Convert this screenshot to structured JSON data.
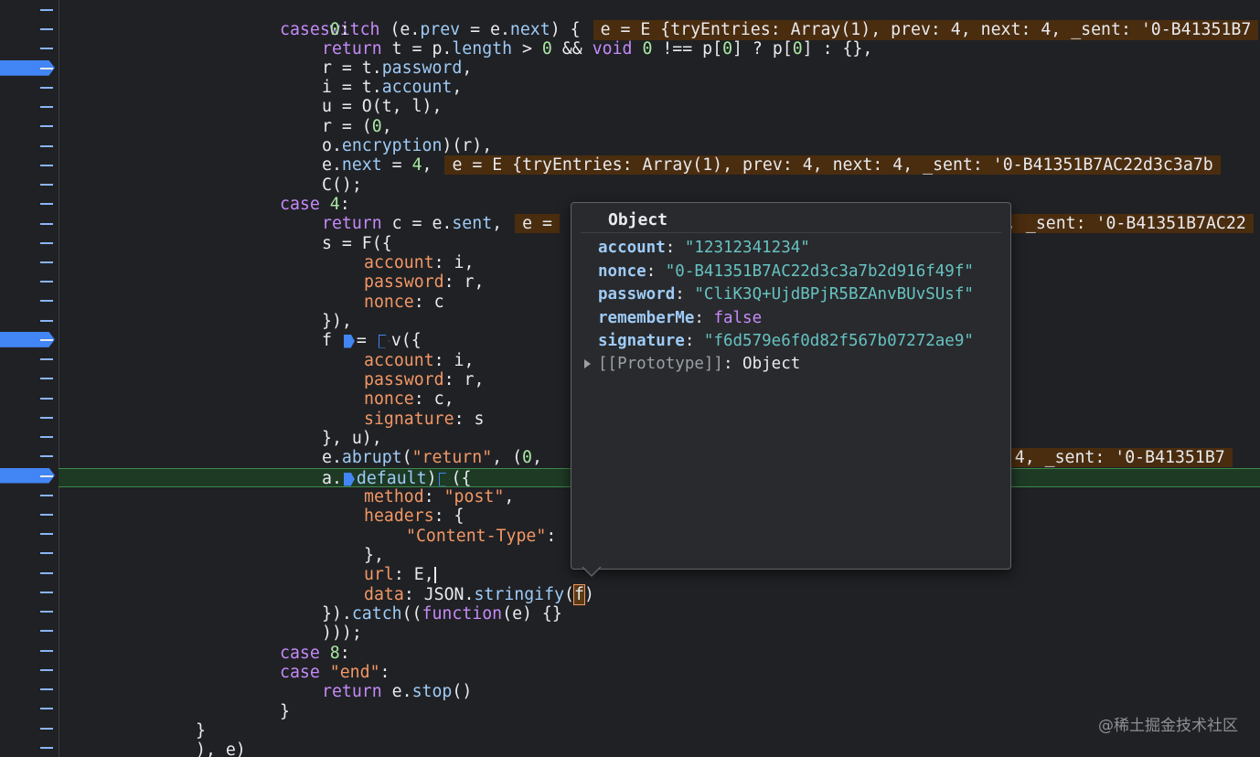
{
  "gutter": {
    "line_count": 39,
    "breakpoint_rows": [
      3,
      17,
      24
    ],
    "breakpoint_color": "#4285f4"
  },
  "code": {
    "switch_head": "switch (e.prev = e.next) {",
    "switch_inline": "e = E {tryEntries: Array(1), prev: 4, next: 4, _sent: '0-B41351B7",
    "case0": "case 0:",
    "return_line": "return t = p.length > 0 && void 0 !== p[0] ? p[0] : {},",
    "r_line": "r = t.password,",
    "i_line": "i = t.account,",
    "u_line": "u = O(t, l),",
    "r2_line": "r = (0,",
    "enc_line": "o.encryption)(r),",
    "next_line": "e.next = 4,",
    "next_inline": "e = E {tryEntries: Array(1), prev: 4, next: 4, _sent: '0-B41351B7AC22d3c3a7b",
    "c_line": "C();",
    "case4": "case 4:",
    "return_c": "return c = e.sent,",
    "return_c_inline_left": "e =",
    "return_c_inline_right": ", _sent: '0-B41351B7AC22",
    "s_line": "s = F({",
    "account_i": "account: i,",
    "password_r": "password: r,",
    "nonce_c": "nonce: c",
    "close_paren": "}),",
    "f_line_pre": "f",
    "f_line_mid": "= ",
    "f_line_post": "v({",
    "account_i2": "account: i,",
    "password_r2": "password: r,",
    "nonce_c2": "nonce: c,",
    "signature_s": "signature: s",
    "close_u": "}, u),",
    "abrupt": "e.abrupt(\"return\", (0,",
    "abrupt_inline": "t: 4, _sent: '0-B41351B7",
    "exec_pre": "a.",
    "exec_mid": "default)",
    "exec_post": "({",
    "method": "method: \"post\",",
    "headers": "headers: {",
    "content_type": "\"Content-Type\":",
    "close_brace": "},",
    "url": "url: E,",
    "data_pre": "data: JSON.stringify(",
    "data_hl": "f",
    "data_post": ")",
    "catch": "}).catch((function(e) {}",
    "close_triple": ")));",
    "case8": "case 8:",
    "case_end": "case \"end\":",
    "return_stop": "return e.stop()",
    "close_switch": "}",
    "close_outer": "}",
    "close_e": "), e)"
  },
  "popover": {
    "title": "Object",
    "rows": [
      {
        "key": "account",
        "value": "\"12312341234\"",
        "kind": "string"
      },
      {
        "key": "nonce",
        "value": "\"0-B41351B7AC22d3c3a7b2d916f49f\"",
        "kind": "string"
      },
      {
        "key": "password",
        "value": "\"CliK3Q+UjdBPjR5BZAnvBUvSUsf\"",
        "kind": "string"
      },
      {
        "key": "rememberMe",
        "value": "false",
        "kind": "bool"
      },
      {
        "key": "signature",
        "value": "\"f6d579e6f0d82f567b07272ae9\"",
        "kind": "string"
      }
    ],
    "prototype_key": "[[Prototype]]",
    "prototype_value": "Object"
  },
  "watermark": "@稀土掘金技术社区"
}
